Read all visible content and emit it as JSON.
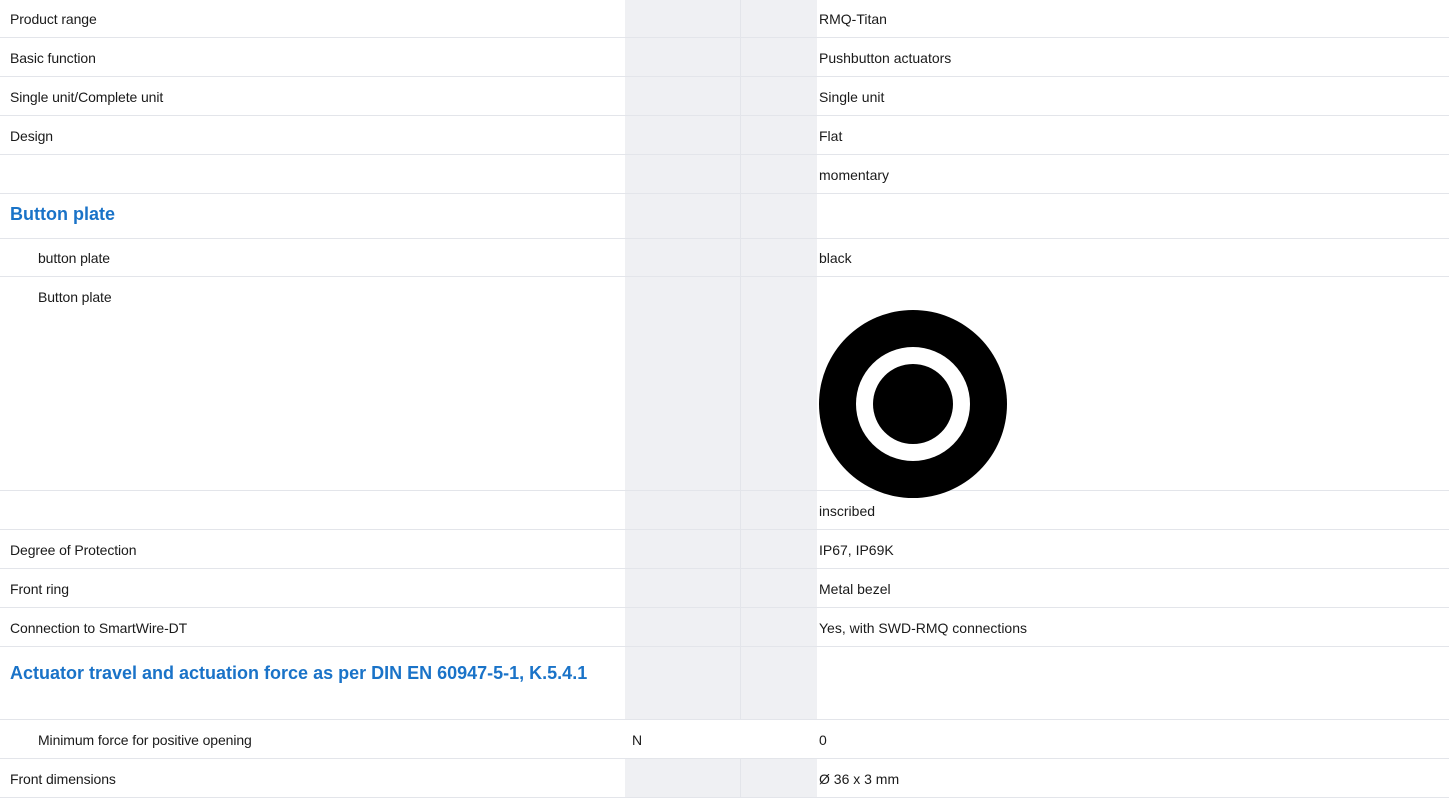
{
  "rows": [
    {
      "label": "Product range",
      "value": "RMQ-Titan"
    },
    {
      "label": "Basic function",
      "value": "Pushbutton actuators"
    },
    {
      "label": "Single unit/Complete unit",
      "value": "Single unit"
    },
    {
      "label": "Design",
      "value": "Flat"
    },
    {
      "label": "",
      "value": "momentary"
    }
  ],
  "section_button_plate": {
    "title": "Button plate",
    "rows": [
      {
        "label": "button plate",
        "value": "black"
      },
      {
        "label": "Button plate",
        "image": "button-plate-ring-icon",
        "colors": {
          "outer": "#000000",
          "ring": "#ffffff",
          "center": "#000000"
        }
      }
    ]
  },
  "rows_after": [
    {
      "label": "",
      "value": "inscribed"
    },
    {
      "label": "Degree of Protection",
      "value": "IP67, IP69K"
    },
    {
      "label": "Front ring",
      "value": "Metal bezel"
    },
    {
      "label": "Connection to SmartWire-DT",
      "value": "Yes, with SWD-RMQ connections"
    }
  ],
  "section_actuator": {
    "title": "Actuator travel and actuation force as per DIN EN 60947-5-1, K.5.4.1",
    "rows": [
      {
        "label": "Minimum force for positive opening",
        "unit": "N",
        "value": "0"
      }
    ]
  },
  "rows_final": [
    {
      "label": "Front dimensions",
      "value": "Ø 36 x 3 mm"
    }
  ],
  "colors": {
    "section_title": "#1a73c8",
    "shade": "#eff0f3",
    "border": "#e3e5ea"
  }
}
